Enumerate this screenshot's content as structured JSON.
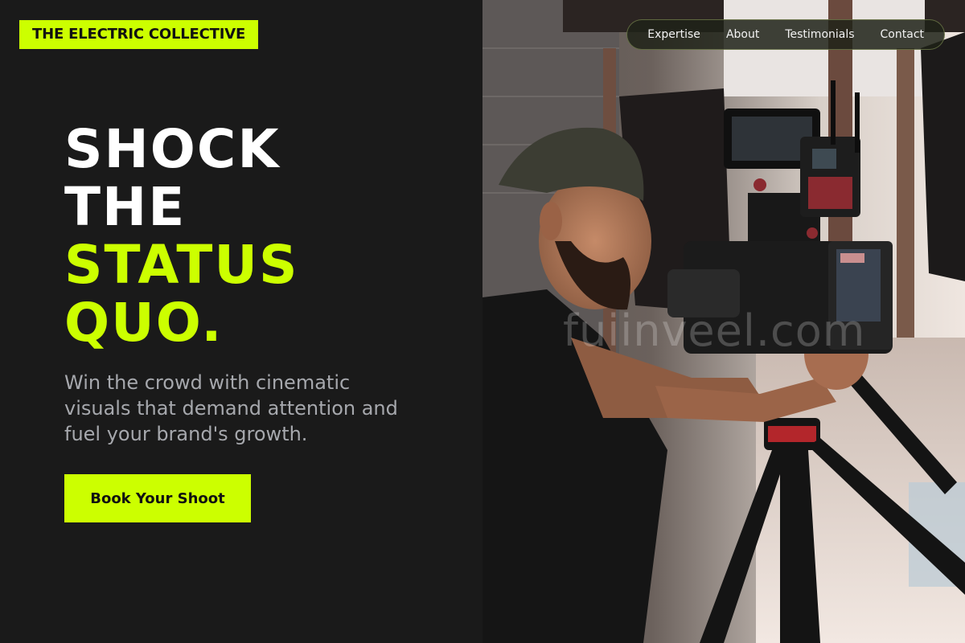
{
  "brand": {
    "name": "THE ELECTRIC COLLECTIVE"
  },
  "nav": {
    "items": [
      "Expertise",
      "About",
      "Testimonials",
      "Contact"
    ]
  },
  "hero": {
    "headline_lines": [
      "SHOCK",
      "THE",
      "STATUS",
      "QUO."
    ],
    "subtext": "Win the crowd with cinematic visuals that demand attention and fuel your brand's growth.",
    "cta_label": "Book Your Shoot"
  },
  "photo": {
    "description_icon": "videographer-photo",
    "watermark": "fuiinveel.com"
  },
  "colors": {
    "accent": "#ccff00",
    "background": "#1a1a1a",
    "headline_white": "#ffffff",
    "subtext": "#a6a8ad"
  }
}
